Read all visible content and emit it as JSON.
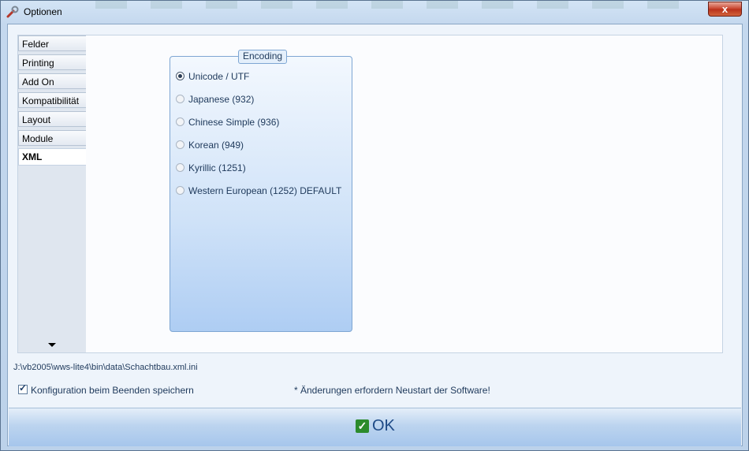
{
  "window": {
    "title": "Optionen",
    "close_label": "x",
    "icon": "wrench-icon"
  },
  "tabs": [
    {
      "label": "Felder"
    },
    {
      "label": "Printing"
    },
    {
      "label": "Add On"
    },
    {
      "label": "Kompatibilität"
    },
    {
      "label": "Layout"
    },
    {
      "label": "Module"
    },
    {
      "label": "XML",
      "active": true
    }
  ],
  "encoding": {
    "group_label": "Encoding",
    "options": [
      {
        "label": "Unicode / UTF",
        "checked": true
      },
      {
        "label": "Japanese (932)",
        "checked": false
      },
      {
        "label": "Chinese Simple (936)",
        "checked": false
      },
      {
        "label": "Korean (949)",
        "checked": false
      },
      {
        "label": "Kyrillic (1251)",
        "checked": false
      },
      {
        "label": "Western European (1252) DEFAULT",
        "checked": false
      }
    ]
  },
  "footer": {
    "path": "J:\\vb2005\\wws-lite4\\bin\\data\\Schachtbau.xml.ini",
    "save_config_label": "Konfiguration beim Beenden speichern",
    "save_config_checked": true,
    "restart_notice": "* Änderungen erfordern Neustart der Software!",
    "ok_label": "OK"
  },
  "colors": {
    "accent": "#1e395b",
    "ok_check": "#2c8b2c",
    "close": "#c7402a"
  }
}
